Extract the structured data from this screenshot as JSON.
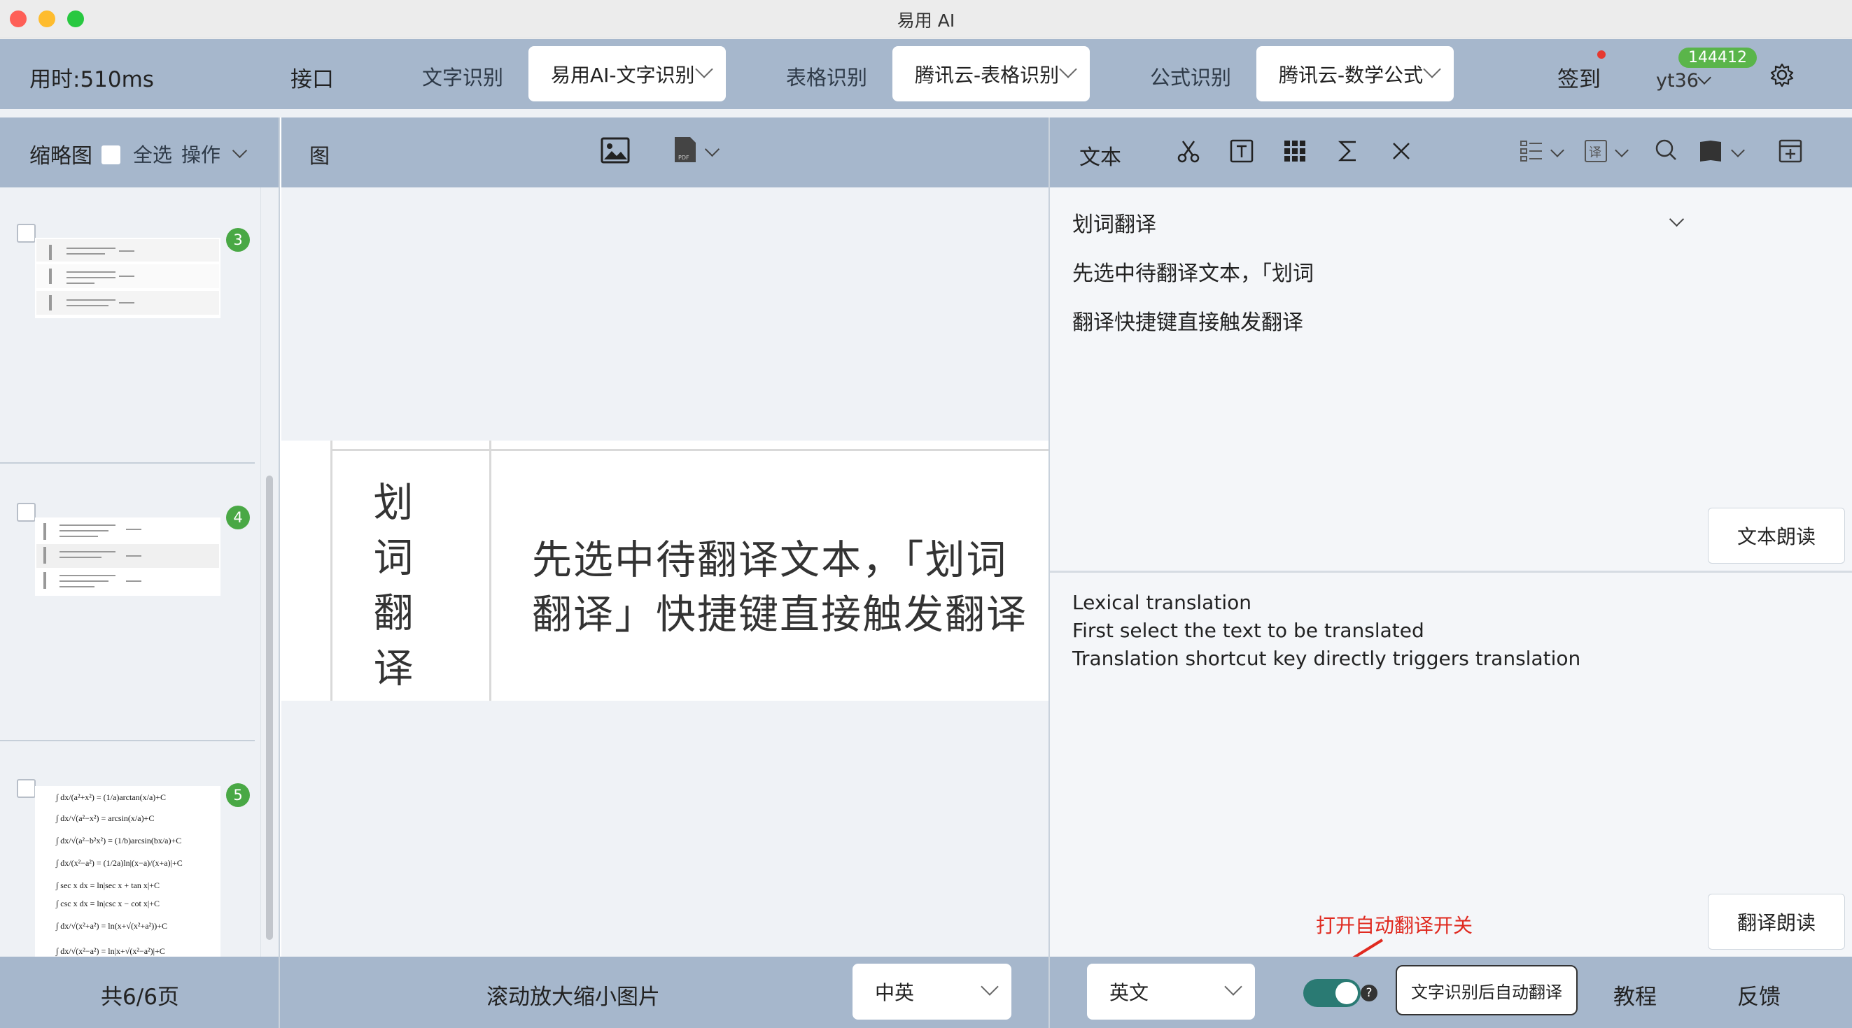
{
  "window": {
    "title": "易用 AI"
  },
  "toolbar": {
    "elapsed": "用时:510ms",
    "api_label": "接口",
    "text_ocr_label": "文字识别",
    "text_ocr_value": "易用AI-文字识别",
    "table_ocr_label": "表格识别",
    "table_ocr_value": "腾讯云-表格识别",
    "formula_ocr_label": "公式识别",
    "formula_ocr_value": "腾讯云-数学公式",
    "checkin": "签到",
    "points": "144412",
    "username": "yt36"
  },
  "left_panel": {
    "thumbs_label": "缩略图",
    "select_all": "全选",
    "ops": "操作",
    "items": [
      {
        "number": "3"
      },
      {
        "number": "4"
      },
      {
        "number": "5"
      }
    ]
  },
  "mid_panel": {
    "image_label": "图",
    "doc_vertical": [
      "划",
      "词",
      "翻",
      "译"
    ],
    "doc_line1": "先选中待翻译文本，「划词",
    "doc_line2": "翻译」快捷键直接触发翻译"
  },
  "right_panel": {
    "text_label": "文本",
    "ocr_lines": [
      "划词翻译",
      "先选中待翻译文本，「划词",
      "翻译快捷键直接触发翻译"
    ],
    "read_text_button": "文本朗读",
    "translation_lines": [
      "Lexical translation",
      "First select the text to be translated",
      "Translation shortcut key directly triggers translation"
    ],
    "read_translation_button": "翻译朗读",
    "annotation": "打开自动翻译开关",
    "tooltip": "文字识别后自动翻译",
    "toggle_on": true
  },
  "bottombar": {
    "pages": "共6/6页",
    "zoom_hint": "滚动放大缩小图片",
    "source_lang": "中英",
    "target_lang": "英文",
    "tutorial": "教程",
    "feedback": "反馈"
  },
  "colors": {
    "toolbar_bg": "#a6b7cc",
    "badge_green": "#5ab54a",
    "toggle_teal": "#2a7a73",
    "annotation_red": "#e02a20"
  }
}
